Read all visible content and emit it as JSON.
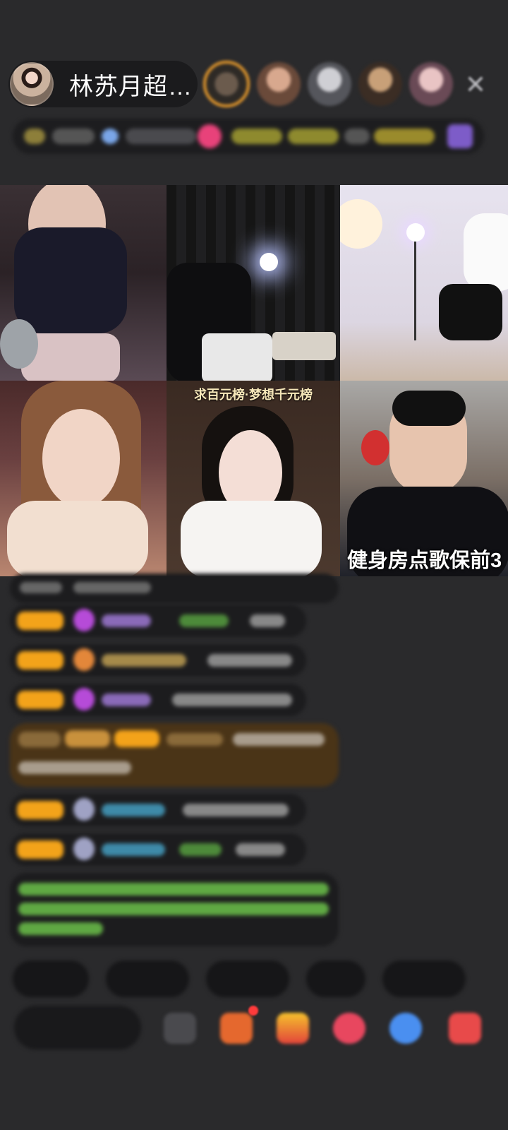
{
  "host": {
    "name": "林苏月超…"
  },
  "grid": {
    "cells": [
      {
        "caption": ""
      },
      {
        "caption": ""
      },
      {
        "caption": ""
      },
      {
        "caption": ""
      },
      {
        "caption": "求百元榜·梦想千元榜"
      },
      {
        "caption": "健身房点歌保前3"
      }
    ]
  },
  "colors": {
    "background": "#2a2a2c",
    "pill": "#1b1b1d",
    "accent_orange": "#f3a31a",
    "accent_purple": "#b64bd8",
    "chat_green": "#5fa843"
  },
  "icons": {
    "close": "close-icon",
    "gift": "gift-icon",
    "emoji": "emoji-icon"
  }
}
